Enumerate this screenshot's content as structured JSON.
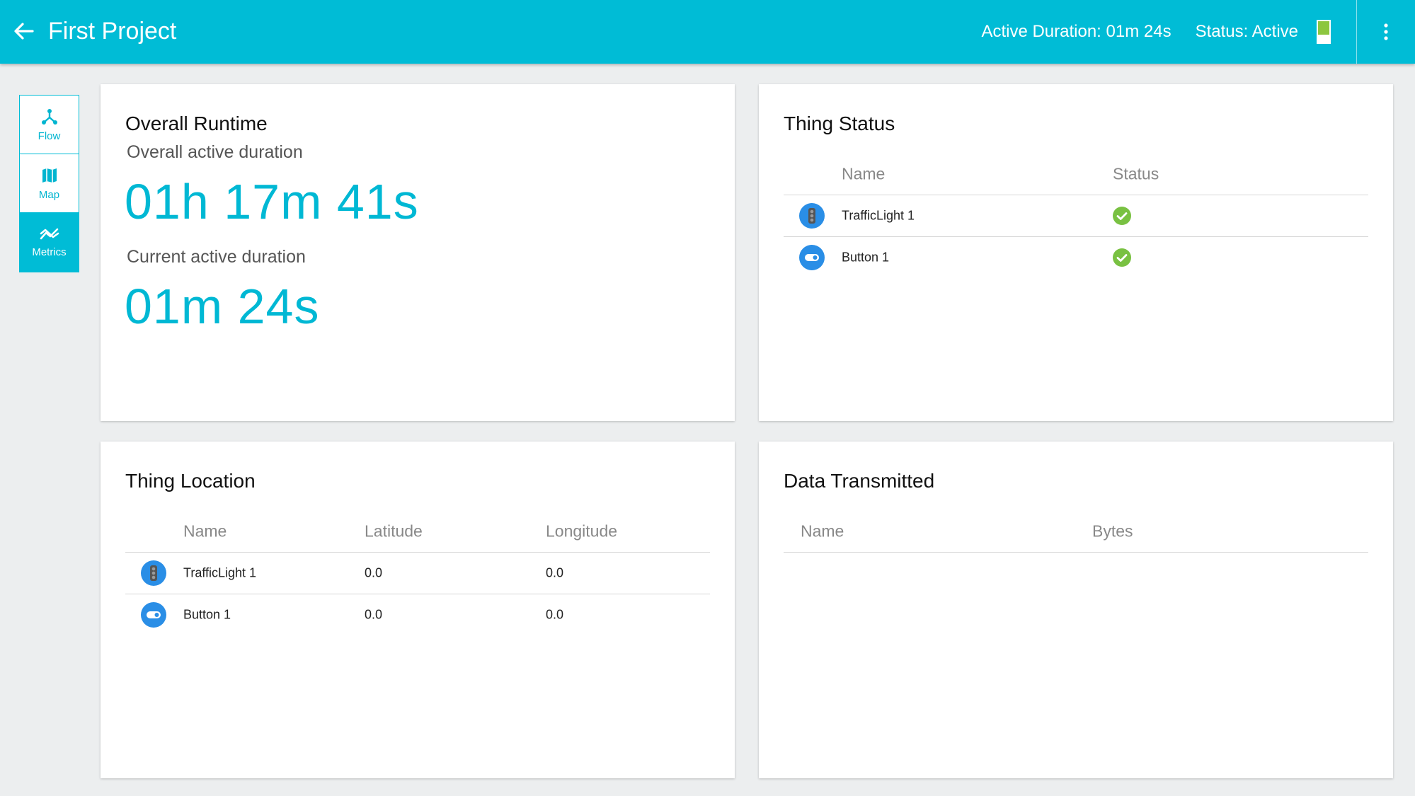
{
  "header": {
    "title": "First Project",
    "active_duration_label": "Active Duration:",
    "active_duration_value": "01m 24s",
    "status_label": "Status:",
    "status_value": "Active",
    "status_level": 0.62,
    "accent_color": "#00bcd6"
  },
  "sidenav": {
    "items": [
      {
        "label": "Flow",
        "icon": "flow-icon",
        "active": false
      },
      {
        "label": "Map",
        "icon": "map-icon",
        "active": false
      },
      {
        "label": "Metrics",
        "icon": "metrics-icon",
        "active": true
      }
    ]
  },
  "runtime": {
    "title": "Overall Runtime",
    "overall_label": "Overall active duration",
    "overall_value": "01h 17m 41s",
    "current_label": "Current active duration",
    "current_value": "01m 24s"
  },
  "thing_status": {
    "title": "Thing Status",
    "columns": [
      "Name",
      "Status"
    ],
    "rows": [
      {
        "name": "TrafficLight 1",
        "icon": "traffic-light-icon",
        "status": "ok"
      },
      {
        "name": "Button 1",
        "icon": "button-icon",
        "status": "ok"
      }
    ]
  },
  "thing_location": {
    "title": "Thing Location",
    "columns": [
      "Name",
      "Latitude",
      "Longitude"
    ],
    "rows": [
      {
        "name": "TrafficLight 1",
        "icon": "traffic-light-icon",
        "latitude": "0.0",
        "longitude": "0.0"
      },
      {
        "name": "Button 1",
        "icon": "button-icon",
        "latitude": "0.0",
        "longitude": "0.0"
      }
    ]
  },
  "data_transmitted": {
    "title": "Data Transmitted",
    "columns": [
      "Name",
      "Bytes"
    ],
    "rows": []
  }
}
